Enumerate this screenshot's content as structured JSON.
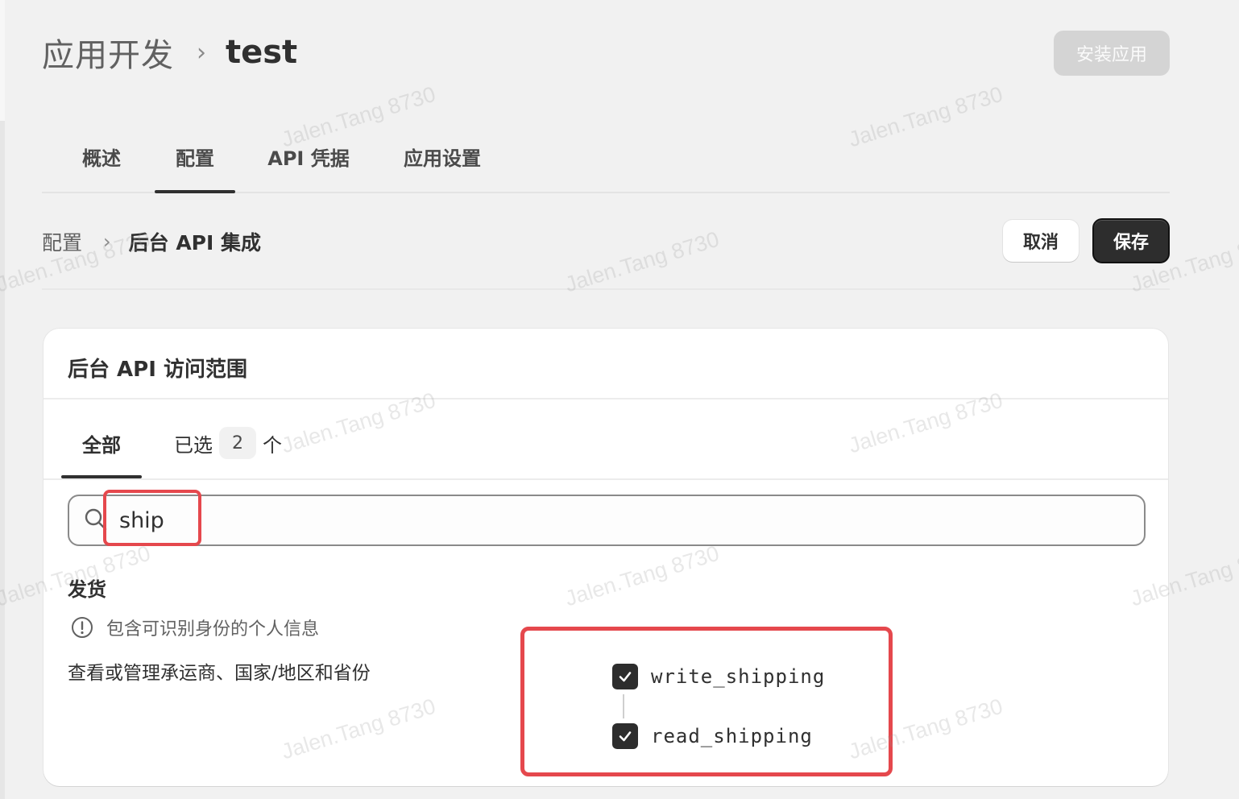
{
  "header": {
    "breadcrumb_root": "应用开发",
    "breadcrumb_sep": "›",
    "app_name": "test",
    "install_label": "安装应用"
  },
  "tabs": [
    {
      "label": "概述"
    },
    {
      "label": "配置",
      "active": true
    },
    {
      "label": "API 凭据"
    },
    {
      "label": "应用设置"
    }
  ],
  "sub_header": {
    "root": "配置",
    "sep": "›",
    "current": "后台 API 集成",
    "cancel_label": "取消",
    "save_label": "保存"
  },
  "card": {
    "title": "后台 API 访问范围",
    "filter_tabs": {
      "all": "全部",
      "selected_prefix": "已选",
      "selected_count": "2",
      "selected_suffix": "个"
    },
    "search": {
      "value": "ship"
    },
    "section": {
      "title": "发货",
      "pii_notice": "包含可识别身份的个人信息",
      "description": "查看或管理承运商、国家/地区和省份",
      "scopes": [
        {
          "name": "write_shipping",
          "checked": true
        },
        {
          "name": "read_shipping",
          "checked": true
        }
      ]
    }
  },
  "watermark": "Jalen.Tang 8730",
  "colors": {
    "primary_button": "#2d2d2d",
    "highlight": "#e5484d",
    "page_bg": "#f1f1f1"
  }
}
